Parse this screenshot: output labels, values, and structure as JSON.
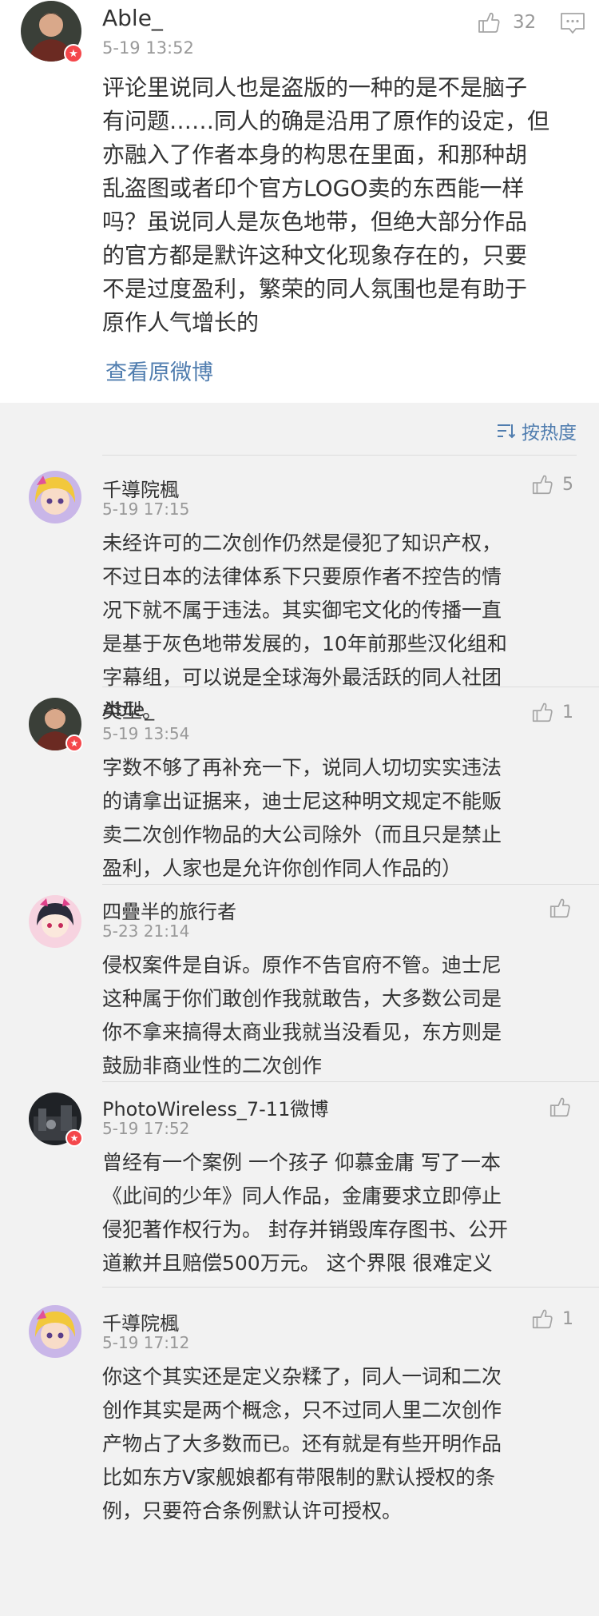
{
  "main_comment": {
    "author": "Able_",
    "time": "5-19 13:52",
    "likes": "32",
    "lines": [
      "评论里说同人也是盗版的一种的是不是脑子",
      "有问题……同人的确是沿用了原作的设定，但",
      "亦融入了作者本身的构思在里面，和那种胡",
      "乱盗图或者印个官方LOGO卖的东西能一样",
      "吗？虽说同人是灰色地带，但绝大部分作品",
      "的官方都是默许这种文化现象存在的，只要",
      "不是过度盈利，繁荣的同人氛围也是有助于",
      "原作人气增长的"
    ],
    "view_original_label": "查看原微博"
  },
  "sort": {
    "label": "按热度"
  },
  "replies": [
    {
      "author": "千導院楓",
      "time": "5-19 17:15",
      "likes": "5",
      "lines": [
        "未经许可的二次创作仍然是侵犯了知识产权，",
        "不过日本的法律体系下只要原作者不控告的情",
        "况下就不属于违法。其实御宅文化的传播一直",
        "是基于灰色地带发展的，10年前那些汉化组和",
        "字幕组，可以说是全球海外最活跃的同人社团",
        "类型。"
      ]
    },
    {
      "author": "Able_",
      "time": "5-19 13:54",
      "likes": "1",
      "lines": [
        "字数不够了再补充一下，说同人切切实实违法",
        "的请拿出证据来，迪士尼这种明文规定不能贩",
        "卖二次创作物品的大公司除外（而且只是禁止",
        "盈利，人家也是允许你创作同人作品的）"
      ]
    },
    {
      "author": "四疊半的旅行者",
      "time": "5-23 21:14",
      "likes": "",
      "lines": [
        "侵权案件是自诉。原作不告官府不管。迪士尼",
        "这种属于你们敢创作我就敢告，大多数公司是",
        "你不拿来搞得太商业我就当没看见，东方则是",
        "鼓励非商业性的二次创作"
      ]
    },
    {
      "author": "PhotoWireless_7-11微博",
      "time": "5-19 17:52",
      "likes": "",
      "lines": [
        "曾经有一个案例 一个孩子 仰慕金庸 写了一本",
        "《此间的少年》同人作品，金庸要求立即停止",
        "侵犯著作权行为。 封存并销毁库存图书、公开",
        "道歉并且赔偿500万元。 这个界限 很难定义"
      ]
    },
    {
      "author": "千導院楓",
      "time": "5-19 17:12",
      "likes": "1",
      "lines": [
        "你这个其实还是定义杂糅了，同人一词和二次",
        "创作其实是两个概念，只不过同人里二次创作",
        "产物占了大多数而已。还有就是有些开明作品",
        "比如东方V家舰娘都有带限制的默认授权的条",
        "例，只要符合条例默认许可授权。"
      ]
    }
  ],
  "colors": {
    "link": "#507daf",
    "text": "#333333",
    "meta": "#999999",
    "verified_badge": "#f4474b",
    "background_gray": "#f2f2f2"
  },
  "icons": {
    "like": "thumbs-up-icon",
    "comment": "comment-icon",
    "sort": "sort-icon",
    "verified": "verified-badge-icon"
  }
}
